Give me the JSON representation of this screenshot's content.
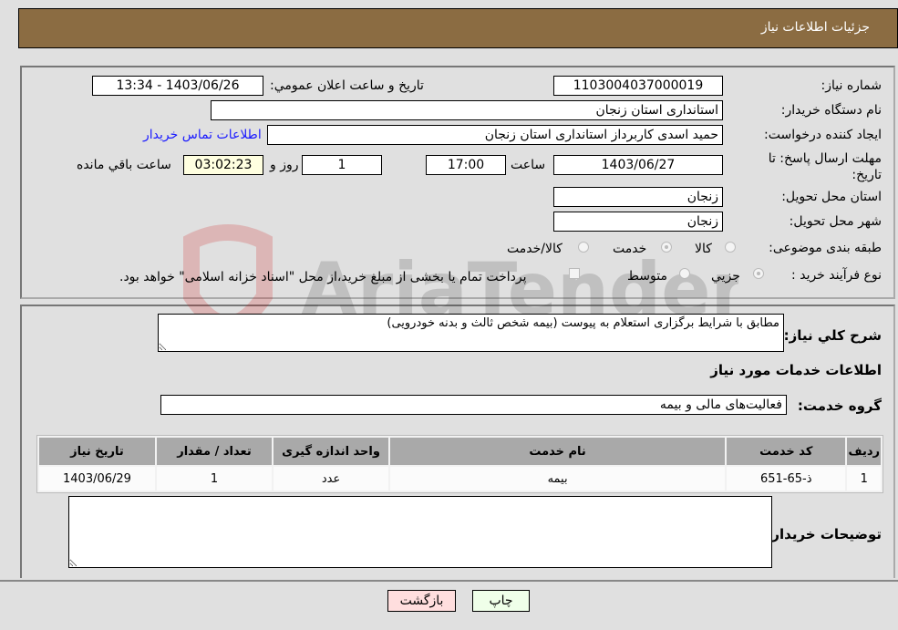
{
  "header": {
    "title": "جزئیات اطلاعات نیاز"
  },
  "details": {
    "need_number": {
      "label": "شماره نیاز:",
      "value": "1103004037000019"
    },
    "announce_datetime": {
      "label": "تاریخ و ساعت اعلان عمومي:",
      "value": "1403/06/26 - 13:34"
    },
    "buyer_org": {
      "label": "نام دستگاه خریدار:",
      "value": "استانداری استان زنجان"
    },
    "requester": {
      "label": "ایجاد کننده درخواست:",
      "value": "حمید اسدی کاربرداز استانداری استان زنجان"
    },
    "buyer_contact_link": "اطلاعات تماس خریدار",
    "deadline": {
      "label": "مهلت ارسال پاسخ: تا تاریخ:",
      "date": "1403/06/27",
      "time_label": "ساعت",
      "time": "17:00",
      "days": "1",
      "days_label": "روز و",
      "remaining": "03:02:23",
      "remaining_label": "ساعت باقي مانده"
    },
    "delivery_province": {
      "label": "استان محل تحویل:",
      "value": "زنجان"
    },
    "delivery_city": {
      "label": "شهر محل تحویل:",
      "value": "زنجان"
    },
    "category": {
      "label": "طبقه بندی موضوعی:",
      "options": [
        "کالا",
        "خدمت",
        "کالا/خدمت"
      ],
      "selected": "خدمت"
    },
    "purchase_type": {
      "label": "نوع فرآیند خرید :",
      "options": [
        "جزيي",
        "متوسط"
      ],
      "selected": "جزيي",
      "treasury_note": "پرداخت تمام یا بخشی از مبلغ خرید،از محل \"اسناد خزانه اسلامی\" خواهد بود.",
      "treasury_checked": false
    }
  },
  "description": {
    "label": "شرح كلي نياز:",
    "value": "مطابق با شرایط برگزاری استعلام به پیوست (بیمه شخص ثالث و بدنه خودرویی)"
  },
  "services_section_title": "اطلاعات خدمات مورد نیاز",
  "service_group": {
    "label": "گروه خدمت:",
    "value": "فعالیت‌های مالی و بیمه"
  },
  "table": {
    "headers": [
      "ردیف",
      "کد خدمت",
      "نام خدمت",
      "واحد اندازه گیری",
      "تعداد / مقدار",
      "تاریخ نیاز"
    ],
    "rows": [
      [
        "1",
        "ذ-65-651",
        "بیمه",
        "عدد",
        "1",
        "1403/06/29"
      ]
    ]
  },
  "buyer_notes": {
    "label": "توضیحات خریدار:",
    "value": ""
  },
  "buttons": {
    "print": "چاپ",
    "back": "بازگشت"
  },
  "watermark": "AriaTender.net",
  "colors": {
    "header_bg": "#8b6c42",
    "link": "#1a1aff",
    "print_bg": "#efffe9",
    "back_bg": "#ffdede"
  }
}
